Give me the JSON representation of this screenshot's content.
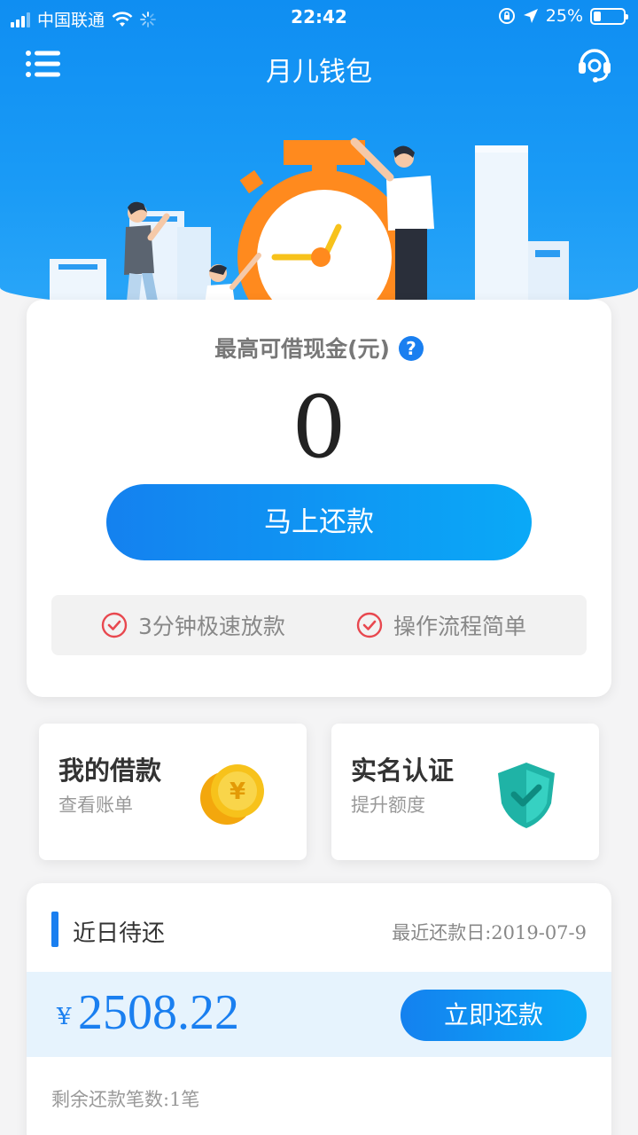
{
  "status_bar": {
    "carrier": "中国联通",
    "time": "22:42",
    "battery_percent": "25%",
    "battery_level": 0.25
  },
  "nav": {
    "title": "月儿钱包",
    "menu_icon": "list-menu-icon",
    "support_icon": "headset-support-icon"
  },
  "limit": {
    "label": "最高可借现金(元)",
    "help": "?",
    "value": "0"
  },
  "repay_button": "马上还款",
  "features": [
    "3分钟极速放款",
    "操作流程简单"
  ],
  "cards": {
    "loans": {
      "title": "我的借款",
      "subtitle": "查看账单",
      "icon": "coin-yen-icon",
      "glyph": "¥"
    },
    "verify": {
      "title": "实名认证",
      "subtitle": "提升额度",
      "icon": "shield-check-icon"
    }
  },
  "recent": {
    "title": "近日待还",
    "date_label": "最近还款日:2019-07-9",
    "currency": "¥",
    "amount": "2508.22",
    "pay_button": "立即还款",
    "remaining": "剩余还款笔数:1笔"
  },
  "colors": {
    "primary": "#1a7ff0",
    "hero_top": "#0f8ef2",
    "check_red": "#e8484f",
    "coin_gold": "#f7c21b",
    "shield_teal": "#25c7b7"
  }
}
